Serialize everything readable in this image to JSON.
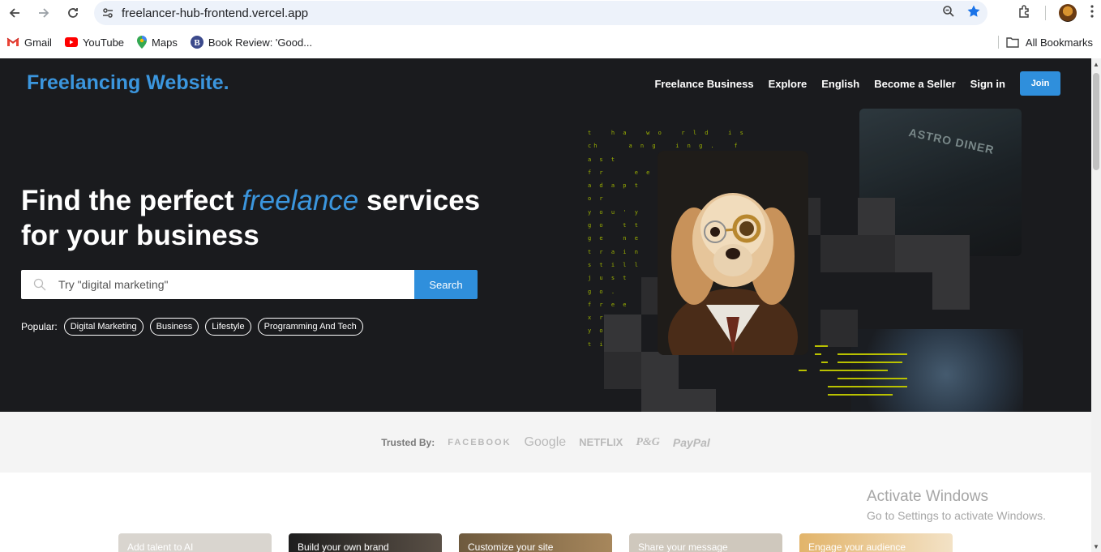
{
  "browser": {
    "url": "freelancer-hub-frontend.vercel.app",
    "bookmarks": [
      {
        "label": "Gmail",
        "icon": "gmail-icon"
      },
      {
        "label": "YouTube",
        "icon": "youtube-icon"
      },
      {
        "label": "Maps",
        "icon": "maps-icon"
      },
      {
        "label": "Book Review: 'Good...",
        "icon": "book-icon"
      }
    ],
    "all_bookmarks": "All Bookmarks"
  },
  "header": {
    "logo": "Freelancing Website.",
    "nav": [
      "Freelance Business",
      "Explore",
      "English",
      "Become a Seller",
      "Sign in"
    ],
    "join": "Join"
  },
  "hero": {
    "headline_start": "Find the perfect",
    "headline_accent": "freelance",
    "headline_end": "services",
    "headline_line2": "for your business",
    "search_placeholder": "Try \"digital marketing\"",
    "search_button": "Search",
    "popular_label": "Popular:",
    "popular_tags": [
      "Digital Marketing",
      "Business",
      "Lifestyle",
      "Programming And Tech"
    ]
  },
  "art": {
    "matrix_text": "t   h a   w o   r l d   i s\nch     a n g   i n g .   f\na s t\nf r     e e\na d a p t\no r\ny o u ' y\ng o   t t\ng e   n e\nt r a i n\ns t i l l\nj u s t\ng o .\nf r e e\nx r e\ny o\nt i",
    "city_sign": "ASTRO DINER"
  },
  "trusted": {
    "label": "Trusted By:",
    "brands": [
      "FACEBOOK",
      "Google",
      "NETFLIX",
      "P&G",
      "PayPal"
    ]
  },
  "cards": [
    {
      "label": "Add talent to AI",
      "color": "#d9d5cf"
    },
    {
      "label": "Build your own brand",
      "color": "#2a2a2a"
    },
    {
      "label": "Customize your site",
      "color": "#6e5a3e"
    },
    {
      "label": "Share your message",
      "color": "#cfc8bd"
    },
    {
      "label": "Engage your audience",
      "color": "#e2b46a"
    }
  ],
  "activate_windows": {
    "title": "Activate Windows",
    "subtitle": "Go to Settings to activate Windows."
  },
  "colors": {
    "accent": "#3b96de",
    "hero_bg": "#1a1b1e"
  }
}
